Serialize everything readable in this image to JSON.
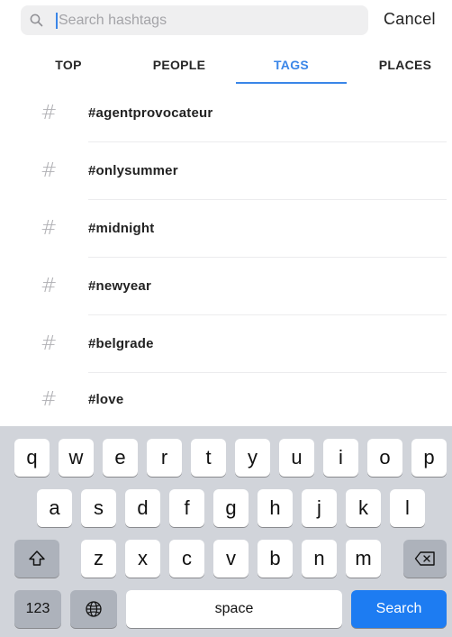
{
  "search": {
    "placeholder": "Search hashtags",
    "cancel_label": "Cancel"
  },
  "tabs": [
    {
      "label": "TOP",
      "active": false
    },
    {
      "label": "PEOPLE",
      "active": false
    },
    {
      "label": "TAGS",
      "active": true
    },
    {
      "label": "PLACES",
      "active": false
    }
  ],
  "tags": {
    "hash_symbol": "#",
    "items": [
      "#agentprovocateur",
      "#onlysummer",
      "#midnight",
      "#newyear",
      "#belgrade",
      "#love"
    ]
  },
  "keyboard": {
    "row1": [
      "q",
      "w",
      "e",
      "r",
      "t",
      "y",
      "u",
      "i",
      "o",
      "p"
    ],
    "row2": [
      "a",
      "s",
      "d",
      "f",
      "g",
      "h",
      "j",
      "k",
      "l"
    ],
    "row3": [
      "z",
      "x",
      "c",
      "v",
      "b",
      "n",
      "m"
    ],
    "numbers_label": "123",
    "space_label": "space",
    "search_label": "Search"
  },
  "colors": {
    "accent": "#3a86e8",
    "search_key": "#1d7cf2",
    "keyboard_bg": "#d1d4da"
  },
  "icons": {
    "search": "search-icon",
    "shift": "shift-icon",
    "backspace": "backspace-icon",
    "globe": "globe-icon"
  }
}
